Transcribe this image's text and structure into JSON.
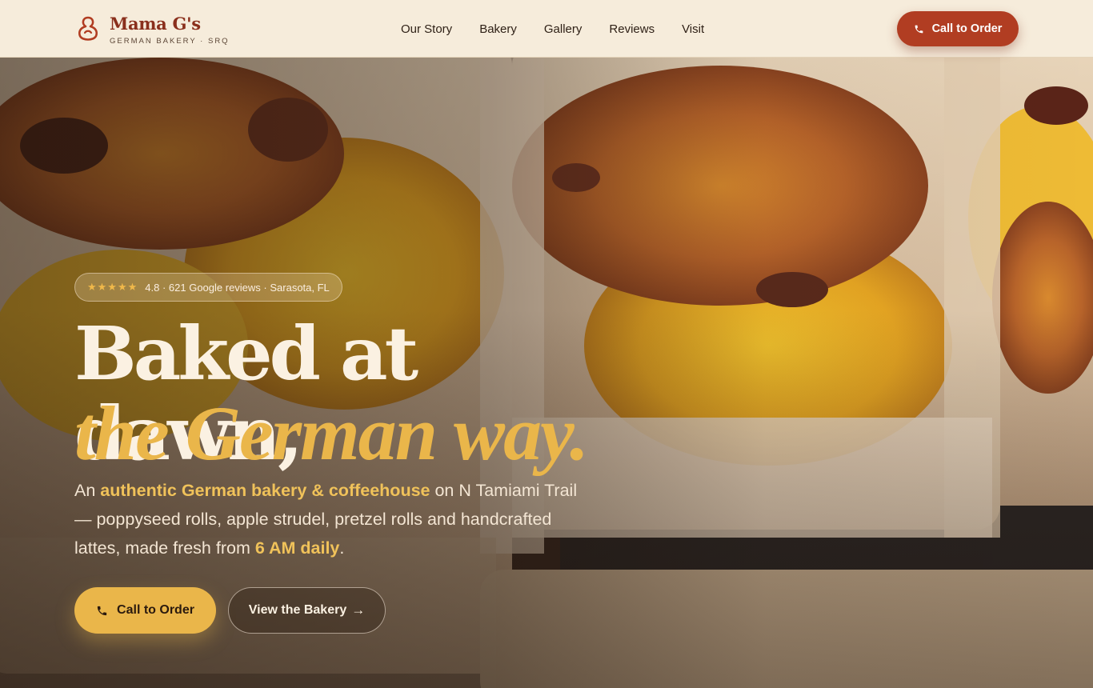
{
  "brand": {
    "name": "Mama G's",
    "tagline": "GERMAN BAKERY · SRQ",
    "logo_icon": "pretzel-icon",
    "accent": "#b13d22",
    "gold": "#eab64a",
    "cream": "#f6ecdb"
  },
  "nav": {
    "items": [
      {
        "label": "Our Story"
      },
      {
        "label": "Bakery"
      },
      {
        "label": "Gallery"
      },
      {
        "label": "Reviews"
      },
      {
        "label": "Visit"
      }
    ],
    "cta_label": "Call to Order",
    "cta_icon": "phone-icon"
  },
  "hero": {
    "rating": {
      "stars": "★★★★★",
      "text": "4.8 · 621 Google reviews · Sarasota, FL"
    },
    "headline_line1": "Baked at dawn,",
    "headline_line2": "the German way.",
    "lede": {
      "p1": "An ",
      "h1": "authentic German bakery & coffeehouse",
      "p2": " on N Tamiami Trail — poppyseed rolls, apple strudel, pretzel rolls and handcrafted lattes, made fresh from ",
      "h2": "6 AM daily",
      "p3": "."
    },
    "primary_cta": "Call to Order",
    "primary_cta_icon": "phone-icon",
    "secondary_cta": "View the Bakery",
    "secondary_cta_arrow": "→"
  }
}
